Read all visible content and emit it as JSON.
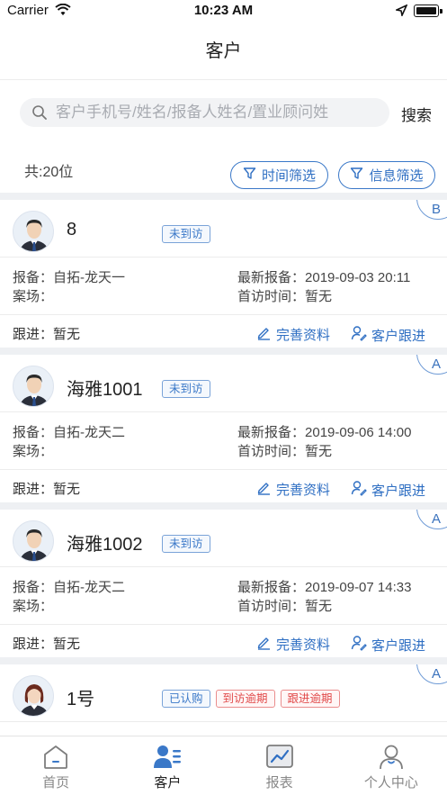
{
  "status_bar": {
    "carrier": "Carrier",
    "time": "10:23 AM"
  },
  "nav": {
    "title": "客户"
  },
  "search": {
    "placeholder": "客户手机号/姓名/报备人姓名/置业顾问姓",
    "button": "搜索"
  },
  "summary": {
    "total": "共:20位"
  },
  "filters": {
    "time": "时间筛选",
    "info": "信息筛选"
  },
  "labels": {
    "report": "报备：",
    "site": "案场：",
    "latest_report": "最新报备：",
    "first_visit": "首访时间：",
    "follow": "跟进：",
    "complete_info": "完善资料",
    "customer_follow": "客户跟进"
  },
  "customers": [
    {
      "grade": "B",
      "name": "8",
      "avatar": "male-avatar",
      "tags": [
        {
          "text": "未到访",
          "color": "blue"
        }
      ],
      "report": "自拓-龙天一",
      "site": "",
      "latest_report": "2019-09-03 20:11",
      "first_visit": "暂无",
      "follow": "暂无"
    },
    {
      "grade": "A",
      "name": "海雅1001",
      "avatar": "male-avatar",
      "tags": [
        {
          "text": "未到访",
          "color": "blue"
        }
      ],
      "report": "自拓-龙天二",
      "site": "",
      "latest_report": "2019-09-06 14:00",
      "first_visit": "暂无",
      "follow": "暂无"
    },
    {
      "grade": "A",
      "name": "海雅1002",
      "avatar": "male-avatar",
      "tags": [
        {
          "text": "未到访",
          "color": "blue"
        }
      ],
      "report": "自拓-龙天二",
      "site": "",
      "latest_report": "2019-09-07 14:33",
      "first_visit": "暂无",
      "follow": "暂无"
    },
    {
      "grade": "A",
      "name": "1号",
      "avatar": "female-avatar",
      "tags": [
        {
          "text": "已认购",
          "color": "blue"
        },
        {
          "text": "到访逾期",
          "color": "red"
        },
        {
          "text": "跟进逾期",
          "color": "red"
        }
      ]
    }
  ],
  "tabbar": [
    {
      "label": "首页",
      "icon": "home-icon",
      "active": false
    },
    {
      "label": "客户",
      "icon": "customers-icon",
      "active": true
    },
    {
      "label": "报表",
      "icon": "report-icon",
      "active": false
    },
    {
      "label": "个人中心",
      "icon": "profile-icon",
      "active": false
    }
  ],
  "colors": {
    "accent": "#2f6fc3",
    "tag_red": "#e14b4b",
    "background_gap": "#eef0f3"
  }
}
